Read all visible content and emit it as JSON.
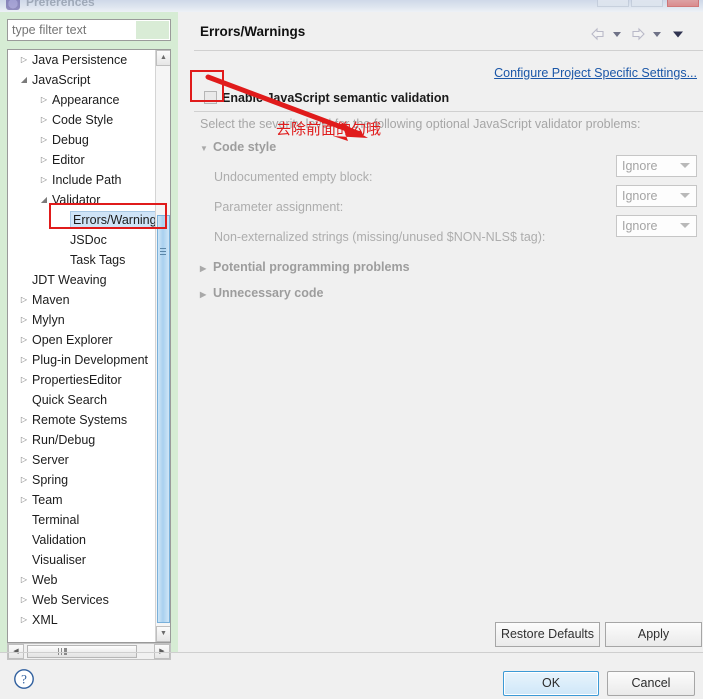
{
  "window": {
    "title": "Preferences",
    "icon": "eclipse-icon",
    "buttons": {
      "minimize": "minimize-button",
      "maximize": "maximize-button",
      "close": "close-button"
    }
  },
  "sidebar": {
    "filter": {
      "value": "",
      "placeholder": "type filter text"
    },
    "tree": [
      {
        "label": "Java Persistence",
        "level": 1,
        "arrow": "collapsed",
        "selected": false
      },
      {
        "label": "JavaScript",
        "level": 1,
        "arrow": "expanded",
        "selected": false
      },
      {
        "label": "Appearance",
        "level": 2,
        "arrow": "collapsed",
        "selected": false
      },
      {
        "label": "Code Style",
        "level": 2,
        "arrow": "collapsed",
        "selected": false
      },
      {
        "label": "Debug",
        "level": 2,
        "arrow": "collapsed",
        "selected": false
      },
      {
        "label": "Editor",
        "level": 2,
        "arrow": "collapsed",
        "selected": false
      },
      {
        "label": "Include Path",
        "level": 2,
        "arrow": "collapsed",
        "selected": false
      },
      {
        "label": "Validator",
        "level": 2,
        "arrow": "expanded",
        "selected": false
      },
      {
        "label": "Errors/Warnings",
        "level": 3,
        "arrow": "none",
        "selected": true
      },
      {
        "label": "JSDoc",
        "level": 3,
        "arrow": "none",
        "selected": false
      },
      {
        "label": "Task Tags",
        "level": 3,
        "arrow": "none",
        "selected": false
      },
      {
        "label": "JDT Weaving",
        "level": 1,
        "arrow": "none",
        "selected": false
      },
      {
        "label": "Maven",
        "level": 1,
        "arrow": "collapsed",
        "selected": false
      },
      {
        "label": "Mylyn",
        "level": 1,
        "arrow": "collapsed",
        "selected": false
      },
      {
        "label": "Open Explorer",
        "level": 1,
        "arrow": "collapsed",
        "selected": false
      },
      {
        "label": "Plug-in Development",
        "level": 1,
        "arrow": "collapsed",
        "selected": false
      },
      {
        "label": "PropertiesEditor",
        "level": 1,
        "arrow": "collapsed",
        "selected": false
      },
      {
        "label": "Quick Search",
        "level": 1,
        "arrow": "none",
        "selected": false
      },
      {
        "label": "Remote Systems",
        "level": 1,
        "arrow": "collapsed",
        "selected": false
      },
      {
        "label": "Run/Debug",
        "level": 1,
        "arrow": "collapsed",
        "selected": false
      },
      {
        "label": "Server",
        "level": 1,
        "arrow": "collapsed",
        "selected": false
      },
      {
        "label": "Spring",
        "level": 1,
        "arrow": "collapsed",
        "selected": false
      },
      {
        "label": "Team",
        "level": 1,
        "arrow": "collapsed",
        "selected": false
      },
      {
        "label": "Terminal",
        "level": 1,
        "arrow": "none",
        "selected": false
      },
      {
        "label": "Validation",
        "level": 1,
        "arrow": "none",
        "selected": false
      },
      {
        "label": "Visualiser",
        "level": 1,
        "arrow": "none",
        "selected": false
      },
      {
        "label": "Web",
        "level": 1,
        "arrow": "collapsed",
        "selected": false
      },
      {
        "label": "Web Services",
        "level": 1,
        "arrow": "collapsed",
        "selected": false
      },
      {
        "label": "XML",
        "level": 1,
        "arrow": "collapsed",
        "selected": false
      }
    ]
  },
  "content": {
    "title": "Errors/Warnings",
    "configure_link": "Configure Project Specific Settings...",
    "enable_checkbox": {
      "label": "Enable JavaScript semantic validation",
      "checked": false
    },
    "hint": "Select the severity level for the following optional JavaScript validator problems:",
    "sections": [
      {
        "name": "Code style",
        "expanded": true
      },
      {
        "name": "Potential programming problems",
        "expanded": false
      },
      {
        "name": "Unnecessary code",
        "expanded": false
      }
    ],
    "options": [
      {
        "label": "Undocumented empty block:",
        "value": "Ignore"
      },
      {
        "label": "Parameter assignment:",
        "value": "Ignore"
      },
      {
        "label": "Non-externalized strings (missing/unused $NON-NLS$ tag):",
        "value": "Ignore"
      }
    ]
  },
  "footer": {
    "restore_defaults": "Restore Defaults",
    "apply": "Apply",
    "ok": "OK",
    "cancel": "Cancel",
    "help": "help-icon"
  },
  "annotation": {
    "text": "去除前面的勾哦",
    "color": "#e01b1b"
  }
}
